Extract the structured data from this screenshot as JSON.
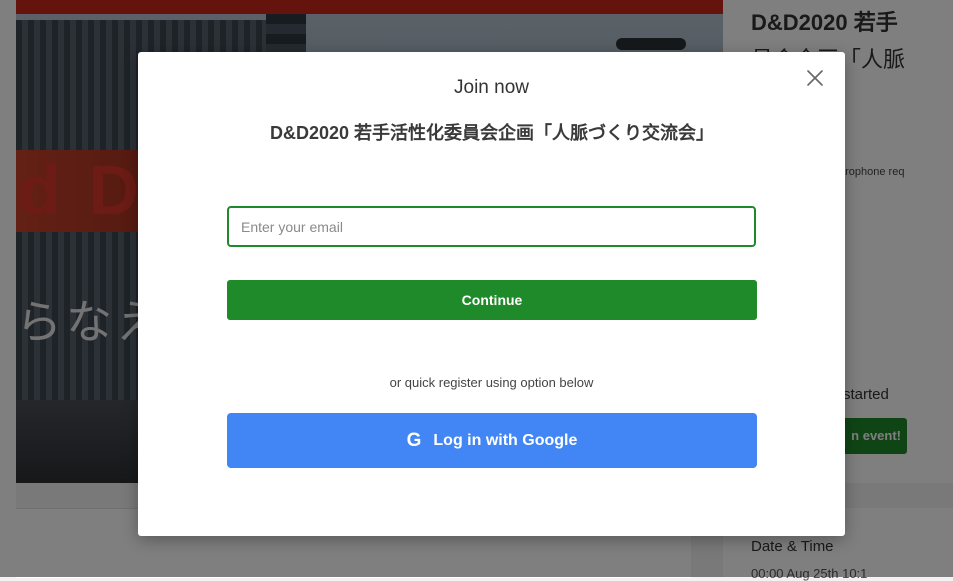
{
  "background": {
    "hero_letters": "d D",
    "hero_jp": "らなえ",
    "event_title_line1": "D&D2020 若手",
    "event_title_line2": "員会企画「人脈",
    "mic_note": "microphone req",
    "started_text": "as started",
    "join_button_label": "n event!",
    "date_label": "Date & Time",
    "date_value": "00:00 Aug 25th 10:1"
  },
  "modal": {
    "heading": "Join now",
    "event_name": "D&D2020 若手活性化委員会企画「人脈づくり交流会」",
    "email": {
      "value": "",
      "placeholder": "Enter your email"
    },
    "continue_label": "Continue",
    "quick_register_text": "or quick register using option below",
    "google": {
      "icon_glyph": "G",
      "label": "Log in with Google"
    },
    "close_icon": "close-icon"
  },
  "colors": {
    "primary_green": "#1e8a2a",
    "google_blue": "#4285f4",
    "overlay": "rgba(0,0,0,0.5)"
  }
}
